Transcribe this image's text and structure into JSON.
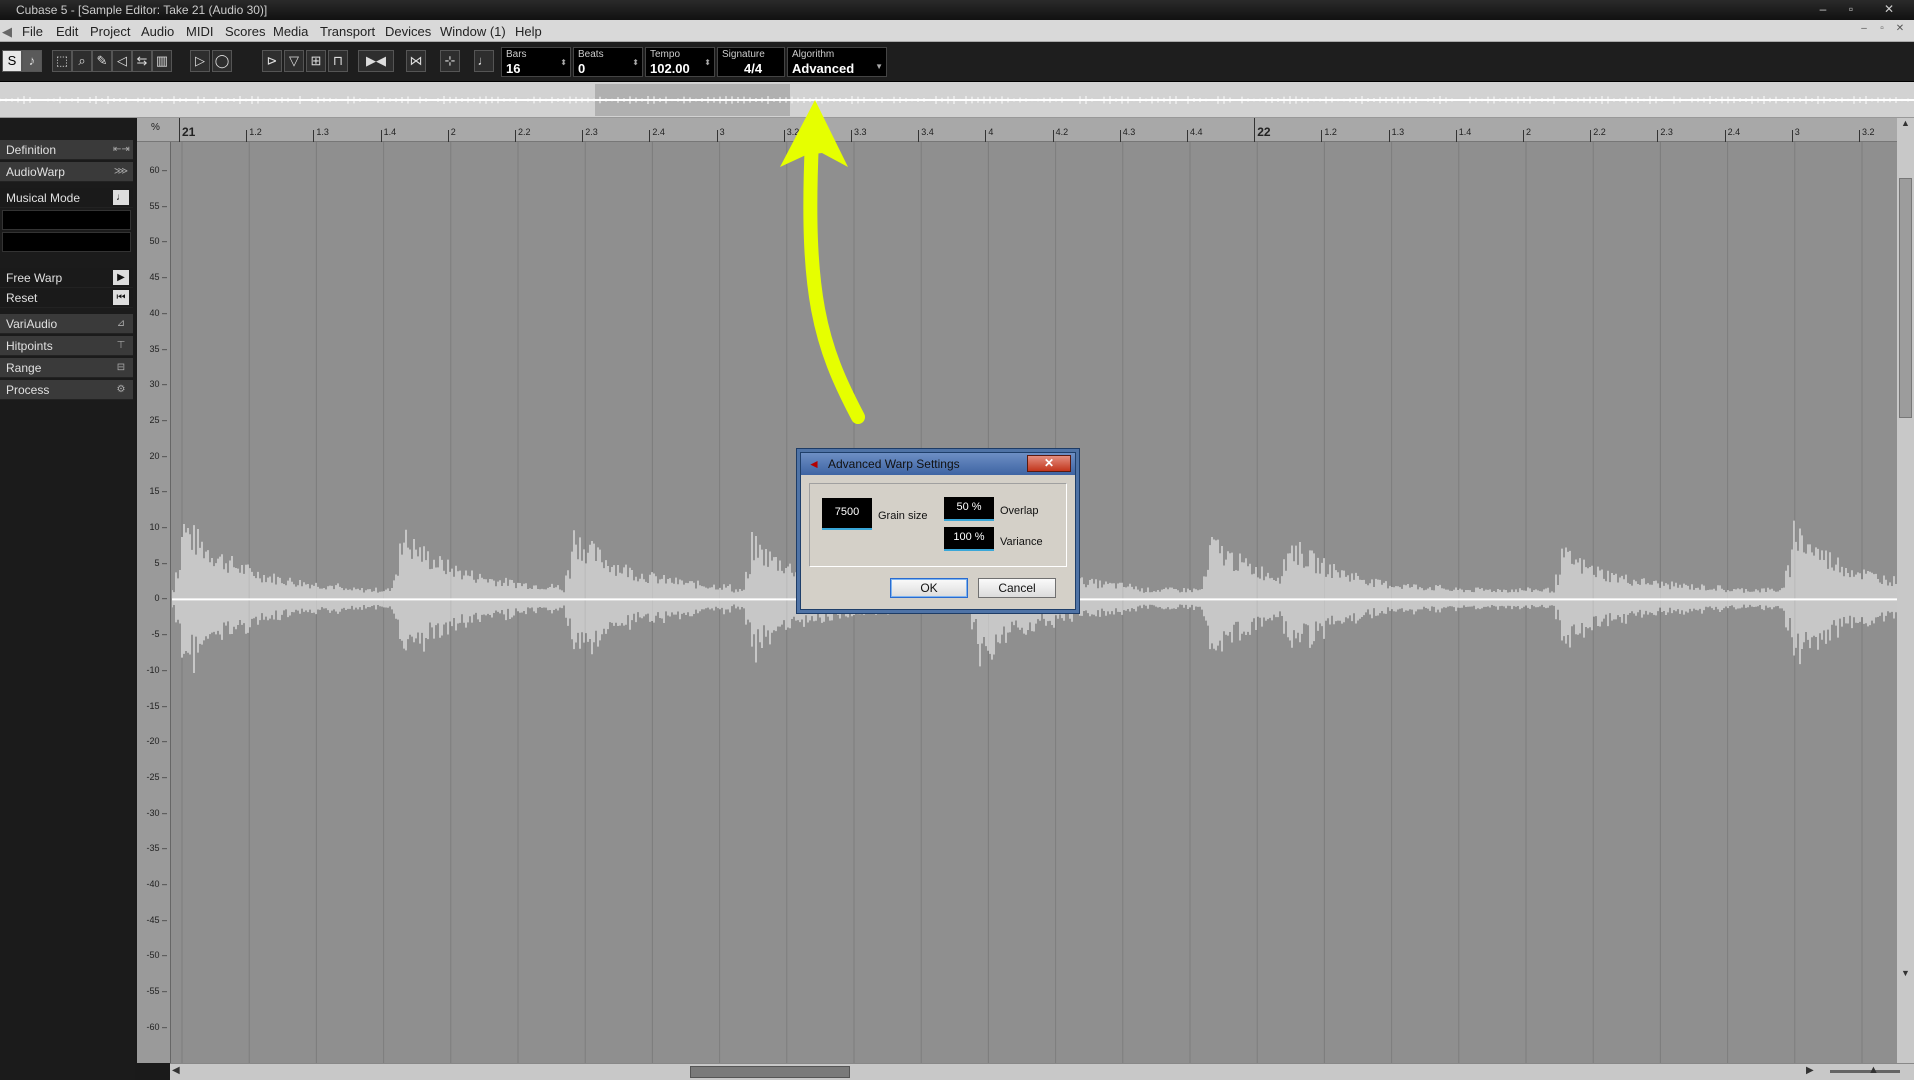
{
  "window": {
    "title": "Cubase 5 - [Sample Editor: Take 21 (Audio 30)]",
    "buttons": [
      "–",
      "▫",
      "✕"
    ]
  },
  "menu": [
    "File",
    "Edit",
    "Project",
    "Audio",
    "MIDI",
    "Scores",
    "Media",
    "Transport",
    "Devices",
    "Window (1)",
    "Help"
  ],
  "toolbar": {
    "bars": {
      "label": "Bars",
      "value": "16"
    },
    "beats": {
      "label": "Beats",
      "value": "0"
    },
    "tempo": {
      "label": "Tempo",
      "value": "102.00"
    },
    "signature": {
      "label": "Signature",
      "value": "4/4"
    },
    "algorithm": {
      "label": "Algorithm",
      "value": "Advanced"
    }
  },
  "inspector": {
    "definition": "Definition",
    "audiowarp": "AudioWarp",
    "musical_mode": "Musical Mode",
    "free_warp": "Free Warp",
    "reset": "Reset",
    "variaudio": "VariAudio",
    "hitpoints": "Hitpoints",
    "range": "Range",
    "process": "Process"
  },
  "ruler": {
    "percent_label": "%",
    "ticks": [
      "21",
      "1.2",
      "1.3",
      "1.4",
      "2",
      "2.2",
      "2.3",
      "2.4",
      "3",
      "3.2",
      "3.3",
      "3.4",
      "4",
      "4.2",
      "4.3",
      "4.4",
      "22",
      "1.2",
      "1.3",
      "1.4",
      "2",
      "2.2",
      "2.3",
      "2.4",
      "3",
      "3.2"
    ]
  },
  "value_scale": [
    "60",
    "55",
    "50",
    "45",
    "40",
    "35",
    "30",
    "25",
    "20",
    "15",
    "10",
    "5",
    "0",
    "-5",
    "-10",
    "-15",
    "-20",
    "-25",
    "-30",
    "-35",
    "-40",
    "-45",
    "-50",
    "-55",
    "-60"
  ],
  "annotation": {
    "color": "#e6ff00",
    "type": "hand-drawn arrow pointing up to overview"
  },
  "dialog": {
    "title": "Advanced Warp Settings",
    "grain_size": {
      "value": "7500",
      "label": "Grain size"
    },
    "overlap": {
      "value": "50 %",
      "label": "Overlap"
    },
    "variance": {
      "value": "100 %",
      "label": "Variance"
    },
    "ok": "OK",
    "cancel": "Cancel",
    "close_glyph": "✕"
  },
  "colors": {
    "waveform_bg": "#8f8f8f",
    "waveform": "#ffffff",
    "dialog_bg": "#d4d0c8"
  }
}
